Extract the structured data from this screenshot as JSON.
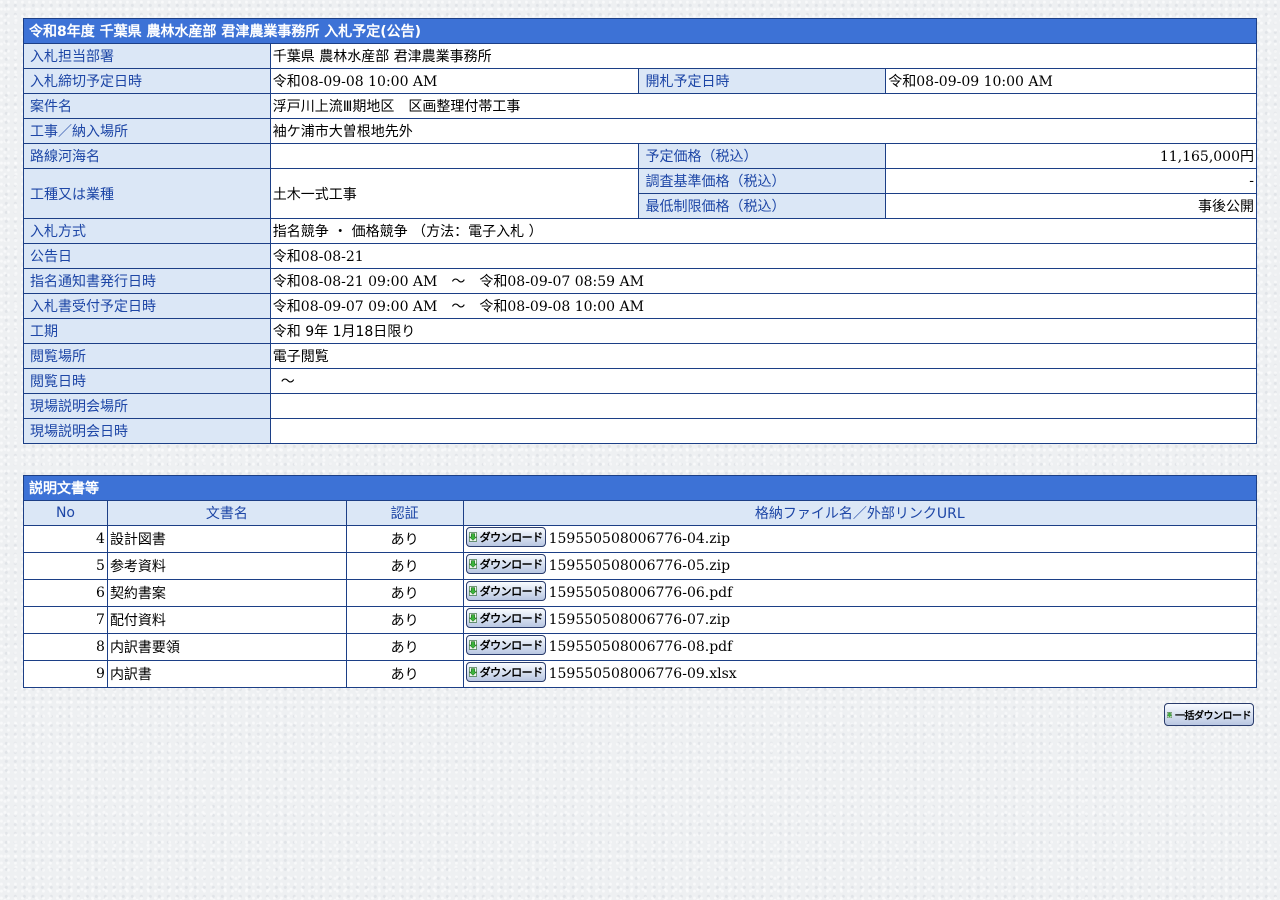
{
  "info": {
    "title": "令和8年度 千葉県 農林水産部 君津農業事務所 入札予定(公告)",
    "rows": {
      "dept": {
        "label": "入札担当部署",
        "value": "千葉県 農林水産部 君津農業事務所"
      },
      "deadline": {
        "label": "入札締切予定日時",
        "value": "令和08-09-08 10:00 AM"
      },
      "opening": {
        "label": "開札予定日時",
        "value": "令和08-09-09 10:00 AM"
      },
      "case_name": {
        "label": "案件名",
        "value": "浮戸川上流Ⅲ期地区　区画整理付帯工事"
      },
      "place": {
        "label": "工事／納入場所",
        "value": "袖ケ浦市大曽根地先外"
      },
      "route": {
        "label": "路線河海名",
        "value": ""
      },
      "planned_price": {
        "label": "予定価格（税込）",
        "value": "11,165,000円"
      },
      "work_type": {
        "label": "工種又は業種",
        "value": "土木一式工事"
      },
      "survey_price": {
        "label": "調査基準価格（税込）",
        "value": "-"
      },
      "min_price": {
        "label": "最低制限価格（税込）",
        "value": "事後公開"
      },
      "method": {
        "label": "入札方式",
        "value": "指名競争 ・ 価格競争 （方法：電子入札 ）"
      },
      "notice_date": {
        "label": "公告日",
        "value": "令和08-08-21"
      },
      "nomination": {
        "label": "指名通知書発行日時",
        "value": "令和08-08-21 09:00 AM　～　令和08-09-07 08:59 AM"
      },
      "acceptance": {
        "label": "入札書受付予定日時",
        "value": "令和08-09-07 09:00 AM　～　令和08-09-08 10:00 AM"
      },
      "period": {
        "label": "工期",
        "value": "令和 9年 1月18日限り"
      },
      "view_place": {
        "label": "閲覧場所",
        "value": "電子閲覧"
      },
      "view_date": {
        "label": "閲覧日時",
        "value": "～"
      },
      "site_place": {
        "label": "現場説明会場所",
        "value": ""
      },
      "site_date": {
        "label": "現場説明会日時",
        "value": ""
      }
    }
  },
  "docs": {
    "title": "説明文書等",
    "headers": {
      "no": "No",
      "name": "文書名",
      "auth": "認証",
      "file": "格納ファイル名／外部リンクURL"
    },
    "download_label": "ダウンロード",
    "items": [
      {
        "no": "4",
        "name": "設計図書",
        "auth": "あり",
        "file": "159550508006776-04.zip"
      },
      {
        "no": "5",
        "name": "参考資料",
        "auth": "あり",
        "file": "159550508006776-05.zip"
      },
      {
        "no": "6",
        "name": "契約書案",
        "auth": "あり",
        "file": "159550508006776-06.pdf"
      },
      {
        "no": "7",
        "name": "配付資料",
        "auth": "あり",
        "file": "159550508006776-07.zip"
      },
      {
        "no": "8",
        "name": "内訳書要領",
        "auth": "あり",
        "file": "159550508006776-08.pdf"
      },
      {
        "no": "9",
        "name": "内訳書",
        "auth": "あり",
        "file": "159550508006776-09.xlsx"
      }
    ]
  },
  "bulk_download_label": "一括ダウンロード",
  "colors": {
    "header_bg": "#3d72d6",
    "label_bg": "#dbe7f6",
    "label_text": "#1d46a6",
    "border": "#1c3f86"
  },
  "icons": {
    "download": "download-arrow-icon"
  }
}
